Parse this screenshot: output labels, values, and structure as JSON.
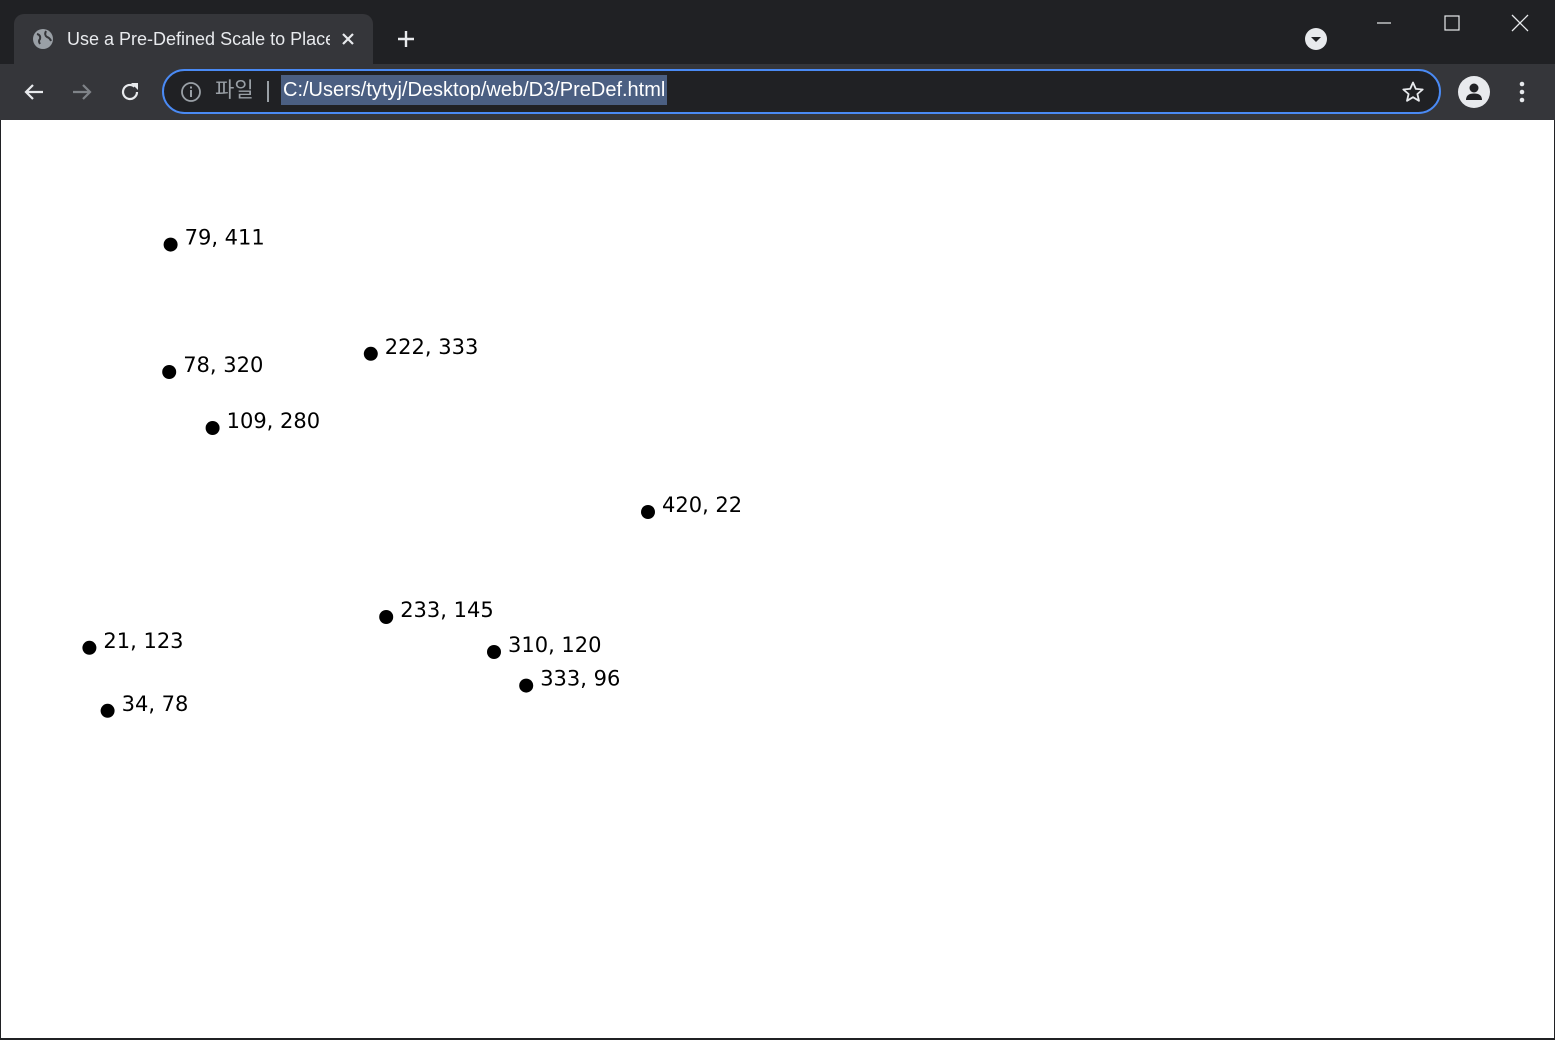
{
  "browser": {
    "tab_title": "Use a Pre-Defined Scale to Place Elements",
    "scheme_label": "파일",
    "url": "C:/Users/tytyj/Desktop/web/D3/PreDef.html",
    "accent_color": "#4a8af4"
  },
  "chart_data": {
    "type": "scatter",
    "title": "",
    "xlabel": "",
    "ylabel": "",
    "xlim": [
      0,
      500
    ],
    "ylim": [
      0,
      500
    ],
    "grid": false,
    "points": [
      {
        "x": 34,
        "y": 78,
        "label": "34, 78"
      },
      {
        "x": 109,
        "y": 280,
        "label": "109, 280"
      },
      {
        "x": 310,
        "y": 120,
        "label": "310, 120"
      },
      {
        "x": 79,
        "y": 411,
        "label": "79, 411"
      },
      {
        "x": 420,
        "y": 220,
        "label": "420, 22"
      },
      {
        "x": 233,
        "y": 145,
        "label": "233, 145"
      },
      {
        "x": 333,
        "y": 96,
        "label": "333, 96"
      },
      {
        "x": 222,
        "y": 333,
        "label": "222, 333"
      },
      {
        "x": 78,
        "y": 320,
        "label": "78, 320"
      },
      {
        "x": 21,
        "y": 123,
        "label": "21, 123"
      }
    ]
  }
}
